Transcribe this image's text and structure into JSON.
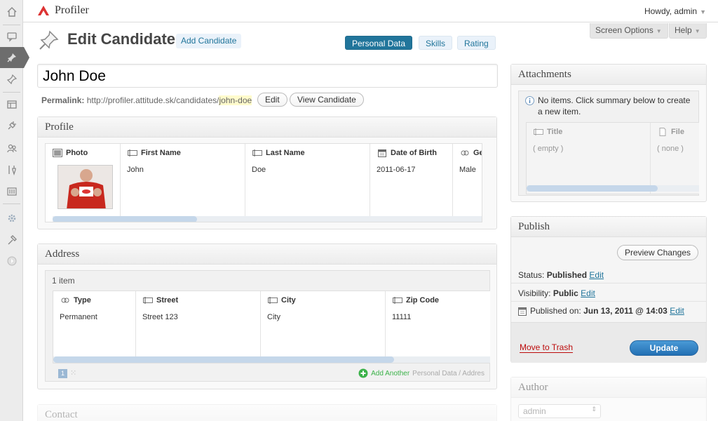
{
  "header": {
    "site_title": "Profiler",
    "howdy": "Howdy, admin"
  },
  "screen_options": "Screen Options",
  "help": "Help",
  "page": {
    "title": "Edit Candidate",
    "add_new": "Add Candidate"
  },
  "nav_tabs": [
    "Personal Data",
    "Skills",
    "Rating"
  ],
  "post": {
    "title": "John Doe",
    "permalink_label": "Permalink:",
    "permalink_base": "http://profiler.attitude.sk/candidates/",
    "permalink_slug": "john-doe",
    "edit_button": "Edit",
    "view_button": "View Candidate"
  },
  "profile": {
    "heading": "Profile",
    "columns": [
      "Photo",
      "First Name",
      "Last Name",
      "Date of Birth",
      "Ge"
    ],
    "values": [
      "",
      "John",
      "Doe",
      "2011-06-17",
      "Male"
    ]
  },
  "address": {
    "heading": "Address",
    "count": "1 item",
    "columns": [
      "Type",
      "Street",
      "City",
      "Zip Code"
    ],
    "values": [
      "Permanent",
      "Street 123",
      "City",
      "11111"
    ],
    "page_number": "1",
    "add_another": "Add Another",
    "add_path": "Personal Data / Addres"
  },
  "contact": {
    "heading": "Contact"
  },
  "attachments": {
    "heading": "Attachments",
    "notice": "No items. Click summary below to create a new item.",
    "columns": [
      "Title",
      "File"
    ],
    "values": [
      "( empty )",
      "( none )"
    ]
  },
  "publish": {
    "heading": "Publish",
    "preview_button": "Preview Changes",
    "status_label": "Status:",
    "status_value": "Published",
    "visibility_label": "Visibility:",
    "visibility_value": "Public",
    "published_label": "Published on:",
    "published_value": "Jun 13, 2011 @ 14:03",
    "edit_link": "Edit",
    "trash_link": "Move to Trash",
    "update_button": "Update"
  },
  "author": {
    "heading": "Author",
    "selected": "admin"
  },
  "colors": {
    "accent": "#21759b",
    "update": "#2e7fc0",
    "trash": "#bc0b0b"
  }
}
